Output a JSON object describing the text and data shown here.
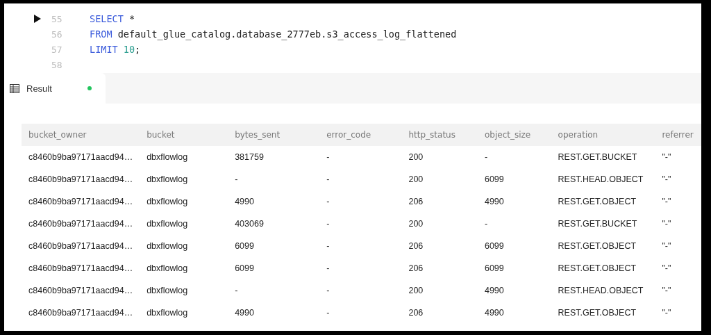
{
  "editor": {
    "lines": [
      {
        "number": "55",
        "run_button": true,
        "tokens": [
          {
            "kind": "keyword",
            "text": "SELECT"
          },
          {
            "kind": "plain",
            "text": " *"
          }
        ]
      },
      {
        "number": "56",
        "tokens": [
          {
            "kind": "keyword",
            "text": "FROM"
          },
          {
            "kind": "plain",
            "text": " default_glue_catalog.database_2777eb.s3_access_log_flattened"
          }
        ]
      },
      {
        "number": "57",
        "tokens": [
          {
            "kind": "keyword",
            "text": "LIMIT"
          },
          {
            "kind": "number",
            "text": " 10"
          },
          {
            "kind": "plain",
            "text": ";"
          }
        ]
      },
      {
        "number": "58"
      }
    ]
  },
  "tabs": [
    {
      "label": "Result",
      "selected": true
    }
  ],
  "table": {
    "columns": [
      "bucket_owner",
      "bucket",
      "bytes_sent",
      "error_code",
      "http_status",
      "object_size",
      "operation",
      "referrer"
    ],
    "rows": [
      [
        "c8460b9ba97171aacd94…",
        "dbxflowlog",
        "381759",
        "-",
        "200",
        "-",
        "REST.GET.BUCKET",
        "\"-\""
      ],
      [
        "c8460b9ba97171aacd94…",
        "dbxflowlog",
        "-",
        "-",
        "200",
        "6099",
        "REST.HEAD.OBJECT",
        "\"-\""
      ],
      [
        "c8460b9ba97171aacd94…",
        "dbxflowlog",
        "4990",
        "-",
        "206",
        "4990",
        "REST.GET.OBJECT",
        "\"-\""
      ],
      [
        "c8460b9ba97171aacd94…",
        "dbxflowlog",
        "403069",
        "-",
        "200",
        "-",
        "REST.GET.BUCKET",
        "\"-\""
      ],
      [
        "c8460b9ba97171aacd94…",
        "dbxflowlog",
        "6099",
        "-",
        "206",
        "6099",
        "REST.GET.OBJECT",
        "\"-\""
      ],
      [
        "c8460b9ba97171aacd94…",
        "dbxflowlog",
        "6099",
        "-",
        "206",
        "6099",
        "REST.GET.OBJECT",
        "\"-\""
      ],
      [
        "c8460b9ba97171aacd94…",
        "dbxflowlog",
        "-",
        "-",
        "200",
        "4990",
        "REST.HEAD.OBJECT",
        "\"-\""
      ],
      [
        "c8460b9ba97171aacd94…",
        "dbxflowlog",
        "4990",
        "-",
        "206",
        "4990",
        "REST.GET.OBJECT",
        "\"-\""
      ]
    ]
  }
}
